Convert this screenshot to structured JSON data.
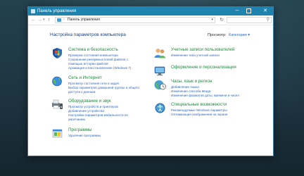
{
  "window": {
    "title": "Панель управления",
    "controls": {
      "minimize": "─",
      "close": "✕"
    }
  },
  "toolbar": {
    "back": "←",
    "forward": "→",
    "recent": "▾",
    "up": "↑",
    "address_separator": "›",
    "address_crumb": "Панель управления",
    "address_dropdown": "▾",
    "refresh": "↻",
    "search_icon": "⚲"
  },
  "header": {
    "title": "Настройка параметров компьютера",
    "view_label": "Просмотр:",
    "view_value": "Категория ▾"
  },
  "categories_left": [
    {
      "icon": "shield-flag-icon",
      "title": "Система и безопасность",
      "links": [
        "Проверка состояния компьютера",
        "Сохранение резервных копий файлов с",
        "помощью истории файлов",
        "Архивация и восстановление (Windows 7)"
      ]
    },
    {
      "icon": "globe-network-icon",
      "title": "Сеть и Интернет",
      "links": [
        "Просмотр состояния сети и задач",
        "Выбор параметров домашней группы и общего",
        "доступа к данным"
      ]
    },
    {
      "icon": "printer-speaker-icon",
      "title": "Оборудование и звук",
      "links": [
        "Просмотр устройств и принтеров",
        "Добавление устройства",
        "Настройка параметров мобильности по",
        "умолчанию"
      ]
    },
    {
      "icon": "programs-icon",
      "title": "Программы",
      "links": [
        "Удаление программы"
      ]
    }
  ],
  "categories_right": [
    {
      "icon": "users-icon",
      "title": "Учетные записи пользователей",
      "links": [
        "Изменение типа учетной записи"
      ]
    },
    {
      "icon": "monitor-palette-icon",
      "title": "Оформление и персонализация",
      "links": []
    },
    {
      "icon": "clock-globe-icon",
      "title": "Часы, язык и регион",
      "links": [
        "Добавление языка",
        "Изменение способа ввода",
        "Изменение форматов даты, времени и чисел"
      ]
    },
    {
      "icon": "accessibility-icon",
      "title": "Специальные возможности",
      "links": [
        "Рекомендуемые Windows параметры",
        "Оптимизация изображения на экране"
      ]
    }
  ],
  "colors": {
    "titlebar": "#1f83b0",
    "category_title": "#1f8a3c",
    "link": "#2a66c4",
    "header": "#1c3f80"
  }
}
